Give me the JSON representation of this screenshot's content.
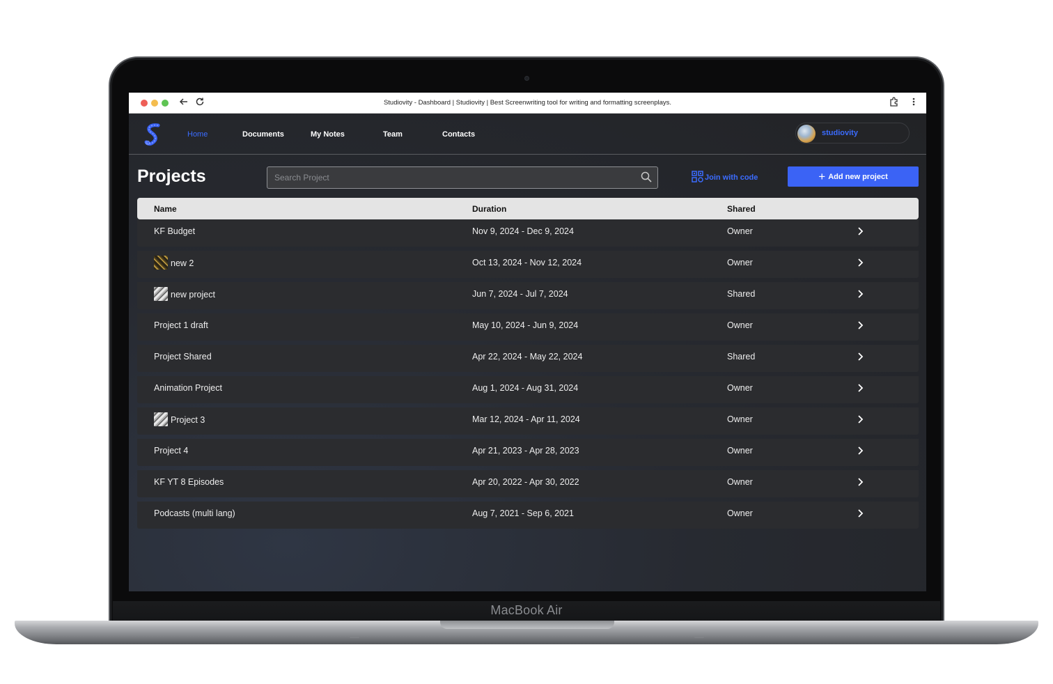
{
  "device": {
    "brand_label": "MacBook Air"
  },
  "browser": {
    "title": "Studiovity - Dashboard | Studiovity | Best Screenwriting tool for writing and formatting screenplays.",
    "back_icon": "arrow-left-icon",
    "reload_icon": "reload-icon",
    "extensions_icon": "puzzle-icon",
    "menu_icon": "kebab-menu-icon"
  },
  "nav": {
    "items": [
      {
        "label": "Home",
        "active": true
      },
      {
        "label": "Documents",
        "active": false
      },
      {
        "label": "My Notes",
        "active": false
      },
      {
        "label": "Team",
        "active": false
      },
      {
        "label": "Contacts",
        "active": false
      }
    ],
    "profile_name": "studiovity"
  },
  "page": {
    "title": "Projects",
    "search_placeholder": "Search Project",
    "join_label": "Join with code",
    "add_label": "Add new project"
  },
  "colors": {
    "accent": "#3b63f5",
    "link": "#3b6cff",
    "row_bg": "#2b2c2f",
    "header_bg": "#e4e4e4"
  },
  "table": {
    "headers": {
      "name": "Name",
      "duration": "Duration",
      "shared": "Shared"
    },
    "rows": [
      {
        "name": "KF Budget",
        "duration": "Nov 9, 2024 - Dec 9, 2024",
        "shared": "Owner",
        "thumb": ""
      },
      {
        "name": "new 2",
        "duration": "Oct 13, 2024 - Nov 12, 2024",
        "shared": "Owner",
        "thumb": "gold"
      },
      {
        "name": "new project",
        "duration": "Jun 7, 2024 - Jul 7, 2024",
        "shared": "Shared",
        "thumb": "gray"
      },
      {
        "name": "Project 1 draft",
        "duration": "May 10, 2024 - Jun 9, 2024",
        "shared": "Owner",
        "thumb": ""
      },
      {
        "name": "Project Shared",
        "duration": "Apr 22, 2024 - May 22, 2024",
        "shared": "Shared",
        "thumb": ""
      },
      {
        "name": "Animation Project",
        "duration": "Aug 1, 2024 - Aug 31, 2024",
        "shared": "Owner",
        "thumb": ""
      },
      {
        "name": "Project 3",
        "duration": "Mar 12, 2024 - Apr 11, 2024",
        "shared": "Owner",
        "thumb": "gray"
      },
      {
        "name": "Project 4",
        "duration": "Apr 21, 2023 - Apr 28, 2023",
        "shared": "Owner",
        "thumb": ""
      },
      {
        "name": "KF YT 8 Episodes",
        "duration": "Apr 20, 2022 - Apr 30, 2022",
        "shared": "Owner",
        "thumb": ""
      },
      {
        "name": "Podcasts (multi lang)",
        "duration": "Aug 7, 2021 - Sep 6, 2021",
        "shared": "Owner",
        "thumb": ""
      }
    ]
  }
}
